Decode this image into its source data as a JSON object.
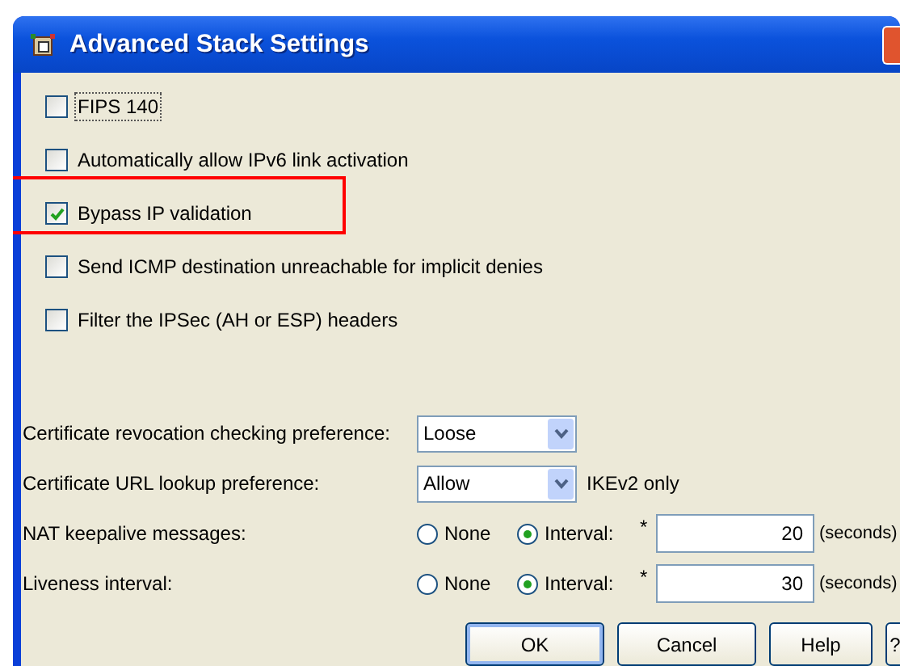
{
  "window": {
    "title": "Advanced Stack Settings"
  },
  "options": [
    {
      "label": "FIPS 140",
      "checked": false,
      "focused": true,
      "highlighted": false
    },
    {
      "label": "Automatically allow IPv6 link activation",
      "checked": false,
      "focused": false,
      "highlighted": false
    },
    {
      "label": "Bypass IP validation",
      "checked": true,
      "focused": false,
      "highlighted": true
    },
    {
      "label": "Send ICMP destination unreachable for implicit denies",
      "checked": false,
      "focused": false,
      "highlighted": false
    },
    {
      "label": "Filter the IPSec (AH or ESP) headers",
      "checked": false,
      "focused": false,
      "highlighted": false
    }
  ],
  "settings": [
    {
      "kind": "dropdown",
      "label": "Certificate revocation checking preference:",
      "value": "Loose"
    },
    {
      "kind": "dropdown",
      "label": "Certificate URL lookup preference:",
      "value": "Allow",
      "note": "IKEv2 only"
    },
    {
      "kind": "interval",
      "label": "NAT keepalive messages:",
      "choices": [
        {
          "label": "None",
          "selected": false
        },
        {
          "label": "Interval:",
          "selected": true
        }
      ],
      "required": "*",
      "value": "20",
      "unit": "(seconds)"
    },
    {
      "kind": "interval",
      "label": "Liveness interval:",
      "choices": [
        {
          "label": "None",
          "selected": false
        },
        {
          "label": "Interval:",
          "selected": true
        }
      ],
      "required": "*",
      "value": "30",
      "unit": "(seconds)"
    }
  ],
  "buttons": [
    {
      "label": "OK",
      "default": true
    },
    {
      "label": "Cancel",
      "default": false
    },
    {
      "label": "Help",
      "default": false
    },
    {
      "label": "?",
      "default": false
    }
  ]
}
